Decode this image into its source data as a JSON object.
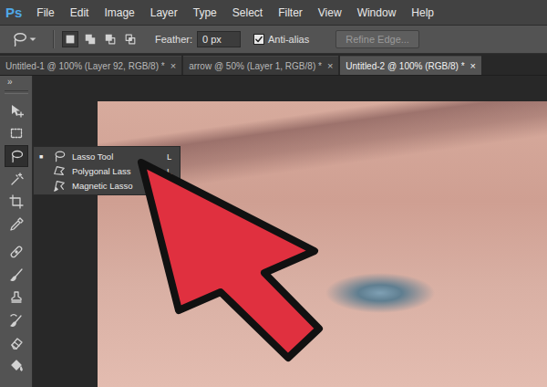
{
  "app": {
    "logo": "Ps"
  },
  "menu_bar": {
    "items": [
      "File",
      "Edit",
      "Image",
      "Layer",
      "Type",
      "Select",
      "Filter",
      "View",
      "Window",
      "Help"
    ]
  },
  "options_bar": {
    "modes": [
      {
        "selected": true
      },
      {
        "selected": false
      },
      {
        "selected": false
      },
      {
        "selected": false
      }
    ],
    "feather": {
      "label": "Feather:",
      "value": "0 px"
    },
    "anti_alias": {
      "label": "Anti-alias",
      "checked": true
    },
    "refine_edge": {
      "label": "Refine Edge...",
      "disabled": true
    }
  },
  "tabs": [
    {
      "label": "Untitled-1 @ 100% (Layer 92, RGB/8) *",
      "close": "×",
      "selected": false
    },
    {
      "label": "arrow @ 50% (Layer 1, RGB/8) *",
      "close": "×",
      "selected": false
    },
    {
      "label": "Untitled-2 @ 100% (RGB/8) *",
      "close": "×",
      "selected": true
    }
  ],
  "toolbar": {
    "collapse": "»",
    "tools": [
      {
        "selected": false
      },
      {
        "selected": false
      },
      {
        "selected": true
      },
      {
        "selected": false
      },
      {
        "selected": false
      },
      {
        "selected": false
      },
      {
        "selected": false
      },
      {
        "selected": false
      },
      {
        "selected": false
      },
      {
        "selected": false
      },
      {
        "selected": false
      },
      {
        "selected": false
      }
    ]
  },
  "tool_menu": {
    "marker": "■",
    "items": [
      {
        "label": "Lasso Tool",
        "shortcut": "L",
        "current": true
      },
      {
        "label": "Polygonal Lass",
        "shortcut": "L",
        "current": false
      },
      {
        "label": "Magnetic Lasso",
        "current": false
      }
    ]
  }
}
